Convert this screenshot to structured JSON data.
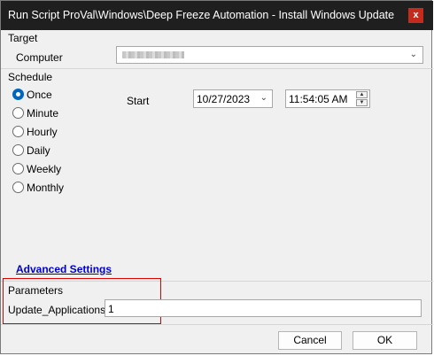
{
  "window": {
    "title": "Run Script ProVal\\Windows\\Deep Freeze Automation - Install Windows Update",
    "close_glyph": "x"
  },
  "target": {
    "section_label": "Target",
    "computer_label": "Computer",
    "computer_value": ""
  },
  "schedule": {
    "section_label": "Schedule",
    "options": [
      "Once",
      "Minute",
      "Hourly",
      "Daily",
      "Weekly",
      "Monthly"
    ],
    "selected": "Once",
    "start_label": "Start",
    "start_date": "10/27/2023",
    "start_time": "11:54:05 AM"
  },
  "advanced_settings_link": "Advanced Settings",
  "parameters": {
    "section_label": "Parameters",
    "items": [
      {
        "name": "Update_Applications",
        "value": "1"
      }
    ]
  },
  "buttons": {
    "cancel": "Cancel",
    "ok": "OK"
  },
  "colors": {
    "titlebar": "#1f1f1f",
    "close": "#c42b1c",
    "accent": "#0067c0",
    "highlight_box": "#e00000",
    "link": "#0000cc"
  },
  "icons": {
    "dropdown": "chevron-down-icon",
    "spinner_up": "caret-up-icon",
    "spinner_down": "caret-down-icon"
  }
}
